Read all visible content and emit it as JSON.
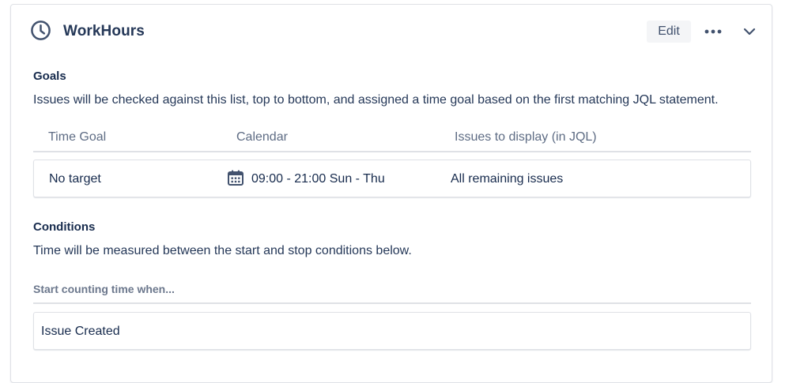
{
  "header": {
    "title": "WorkHours",
    "edit_label": "Edit",
    "icons": {
      "clock": "clock-icon",
      "more": "more-horizontal-icon",
      "chevron": "chevron-down-icon"
    }
  },
  "goals": {
    "title": "Goals",
    "description": "Issues will be checked against this list, top to bottom, and assigned a time goal based on the first matching JQL statement.",
    "columns": [
      "Time Goal",
      "Calendar",
      "Issues to display (in JQL)"
    ],
    "rows": [
      {
        "time_goal": "No target",
        "calendar": "09:00 - 21:00 Sun - Thu",
        "jql": "All remaining issues"
      }
    ]
  },
  "conditions": {
    "title": "Conditions",
    "description": "Time will be measured between the start and stop conditions below.",
    "start_label": "Start counting time when...",
    "start_items": [
      "Issue Created"
    ]
  },
  "colors": {
    "text": "#172b4d",
    "muted": "#5e6c84",
    "border": "#dfe1e6",
    "button_bg": "#f4f5f7"
  }
}
